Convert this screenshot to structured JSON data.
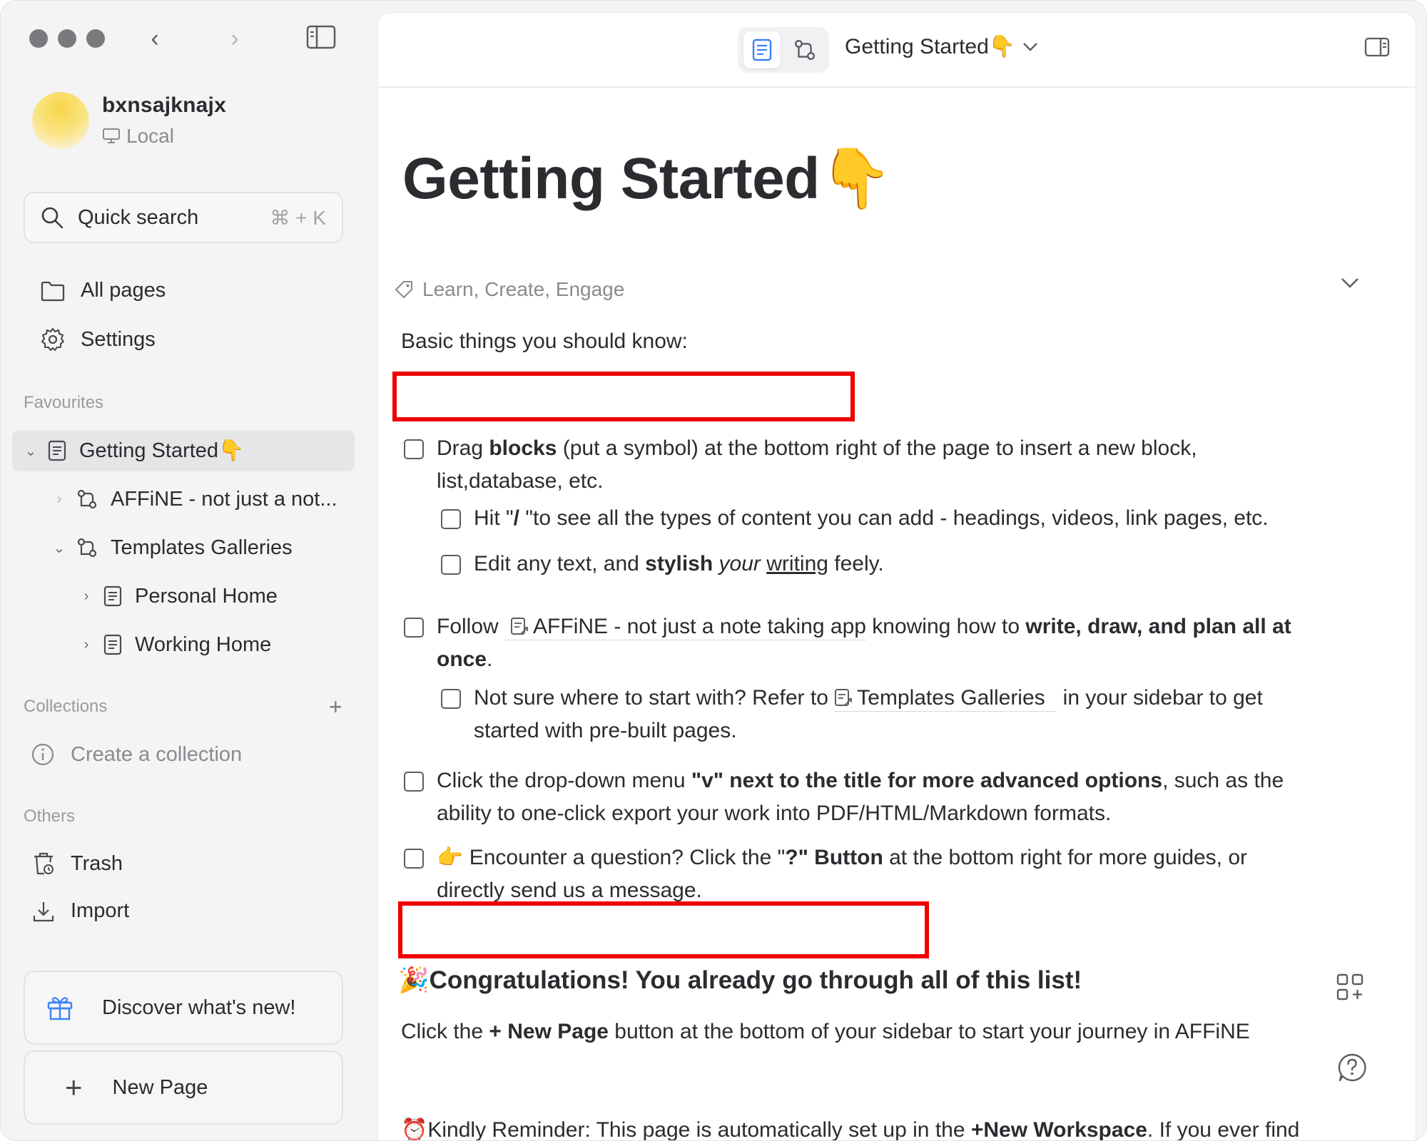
{
  "sidebar": {
    "workspace": {
      "name": "bxnsajknajx",
      "type": "Local"
    },
    "search": {
      "label": "Quick search",
      "shortcut": "⌘ + K"
    },
    "nav": {
      "all_pages": "All pages",
      "settings": "Settings"
    },
    "favourites_label": "Favourites",
    "tree": [
      {
        "label": "Getting Started👇",
        "icon": "page-icon"
      },
      {
        "label": "AFFiNE - not just a not...",
        "icon": "edgeless-icon"
      },
      {
        "label": "Templates Galleries",
        "icon": "edgeless-icon"
      },
      {
        "label": "Personal Home",
        "icon": "page-icon"
      },
      {
        "label": "Working Home",
        "icon": "page-icon"
      }
    ],
    "collections_label": "Collections",
    "create_collection": "Create a collection",
    "others_label": "Others",
    "trash": "Trash",
    "import": "Import",
    "discover": "Discover what's new!",
    "new_page": "New Page"
  },
  "topbar": {
    "title": "Getting Started👇"
  },
  "doc": {
    "title": "Getting Started👇",
    "tags": "Learn, Create, Engage",
    "intro": "Basic things you should know:",
    "todo1": {
      "a": "Drag ",
      "b": "blocks",
      "c": " (put a symbol) at the bottom right of the page to insert a new block,",
      "d": "list,database, etc."
    },
    "todo2": {
      "a": "Hit \"",
      "b": "/",
      "c": " \"to see all the types of content you can add - headings, videos, link pages, etc."
    },
    "todo3": {
      "a": "Edit any text, and ",
      "b": "stylish",
      "c": "your",
      "d": "writing",
      "e": " feely."
    },
    "todo4": {
      "a": "Follow ",
      "link": "AFFiNE - not just a note taking app",
      "c": " knowing how to ",
      "b": "write, draw, and plan all at",
      "d": "once",
      "e": "."
    },
    "todo5": {
      "a": "Not sure where to start with? Refer to ",
      "link": "Templates Galleries",
      "c": "  in your sidebar to get",
      "d": "started with pre-built pages."
    },
    "todo6": {
      "a": "Click the drop-down menu ",
      "b": "\"v\" next to the title for more advanced options",
      "c": ", such as the",
      "d": "ability to one-click export your work into PDF/HTML/Markdown formats."
    },
    "todo7": {
      "a": "👉 Encounter a question?  Click the \"",
      "b": "?\" Button",
      "c": " at the bottom right for more guides, or",
      "d": "directly send us a message."
    },
    "congrats": "🎉Congratulations! You already go through all of this list!",
    "click_new": {
      "a": "Click the ",
      "b": "+ New Page",
      "c": " button at the bottom of your sidebar to start your journey in AFFiNE"
    },
    "reminder": {
      "a": "⏰Kindly Reminder: This page is automatically set up in the ",
      "b": "+New Workspace",
      "c": ". If you ever find"
    }
  },
  "colors": {
    "annotation_box": "#ee0000",
    "avatar": "#f8d54a"
  }
}
